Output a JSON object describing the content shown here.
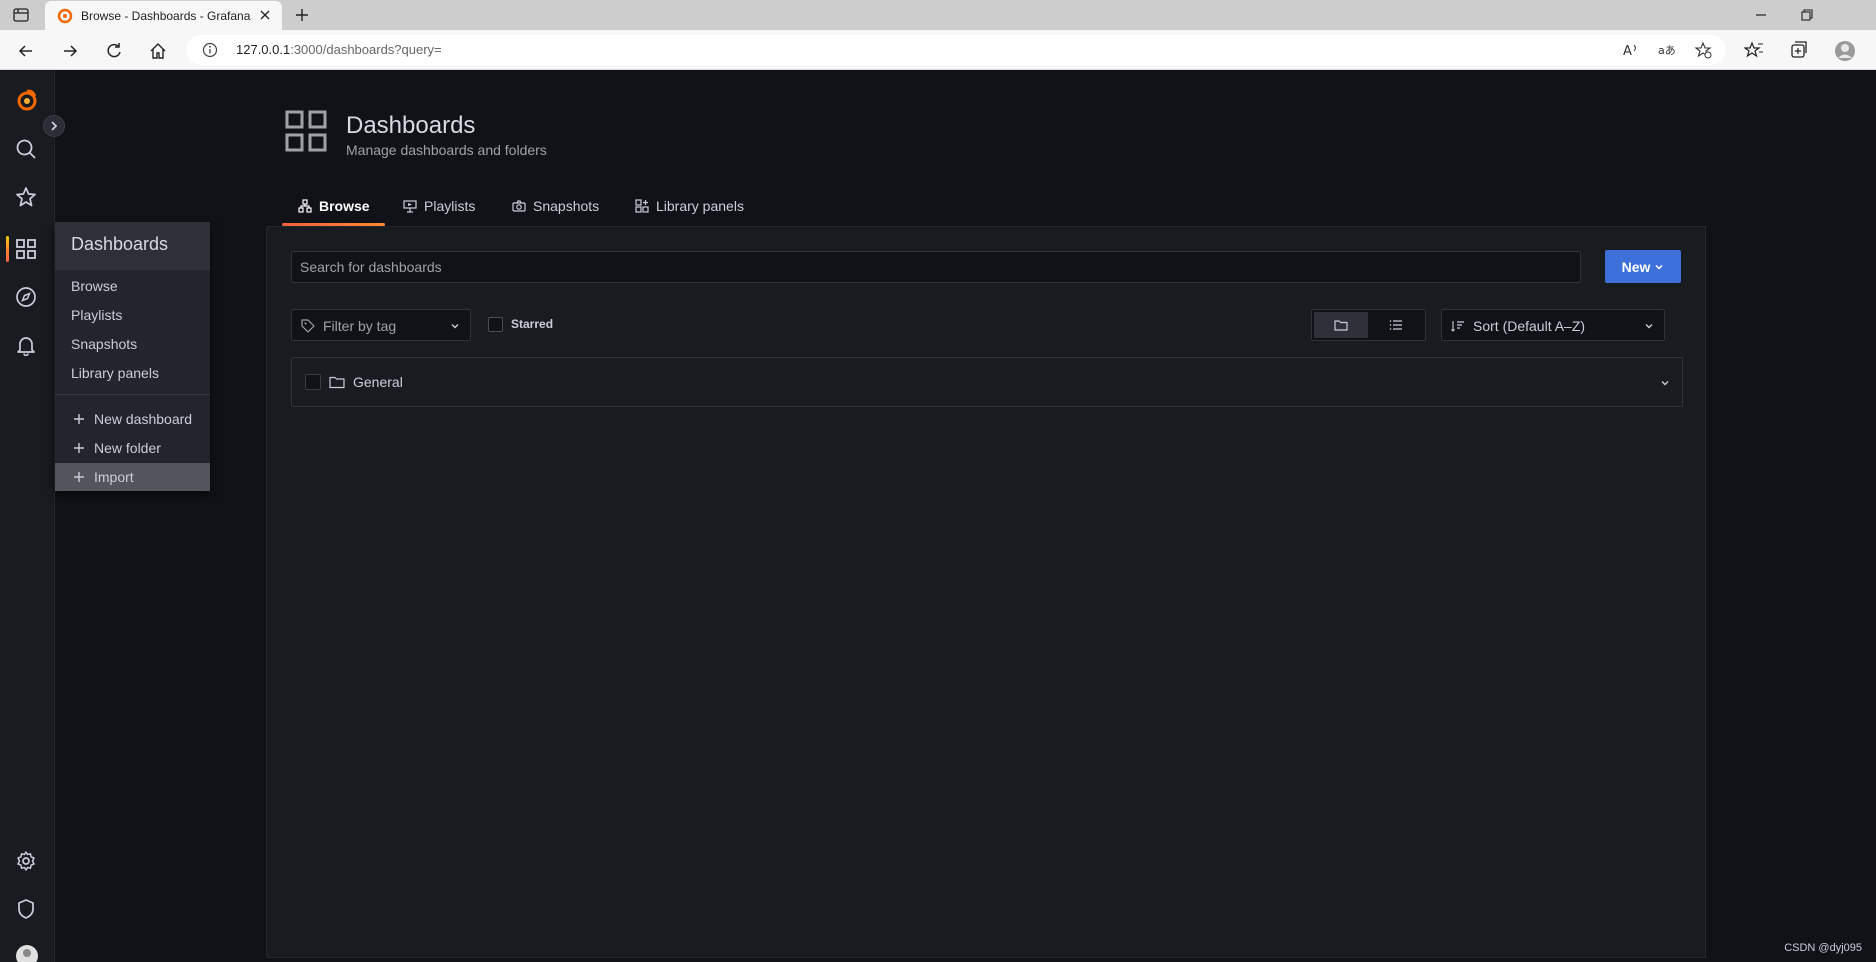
{
  "browser": {
    "tab_title": "Browse - Dashboards - Grafana",
    "url_host": "127.0.0.1",
    "url_path": ":3000/dashboards?query="
  },
  "sidemenu": {
    "items": [
      "grafana-logo-icon",
      "search-icon",
      "star-icon",
      "dashboards-icon",
      "explore-icon",
      "alerting-bell-icon",
      "settings-gear-icon",
      "shield-icon",
      "avatar"
    ]
  },
  "flyout": {
    "header": "Dashboards",
    "items": [
      "Browse",
      "Playlists",
      "Snapshots",
      "Library panels"
    ],
    "actions": [
      "New dashboard",
      "New folder",
      "Import"
    ]
  },
  "page": {
    "title": "Dashboards",
    "subtitle": "Manage dashboards and folders"
  },
  "tabs": [
    {
      "label": "Browse",
      "active": true
    },
    {
      "label": "Playlists",
      "active": false
    },
    {
      "label": "Snapshots",
      "active": false
    },
    {
      "label": "Library panels",
      "active": false
    }
  ],
  "controls": {
    "search_placeholder": "Search for dashboards",
    "new_label": "New",
    "tag_filter_placeholder": "Filter by tag",
    "starred_label": "Starred",
    "sort_label": "Sort (Default A–Z)"
  },
  "folders": [
    {
      "title": "General"
    }
  ],
  "watermark": "CSDN @dyj095",
  "colors": {
    "accent": "#3d71d9",
    "active_tab": "#ff8833",
    "background": "#111217"
  }
}
